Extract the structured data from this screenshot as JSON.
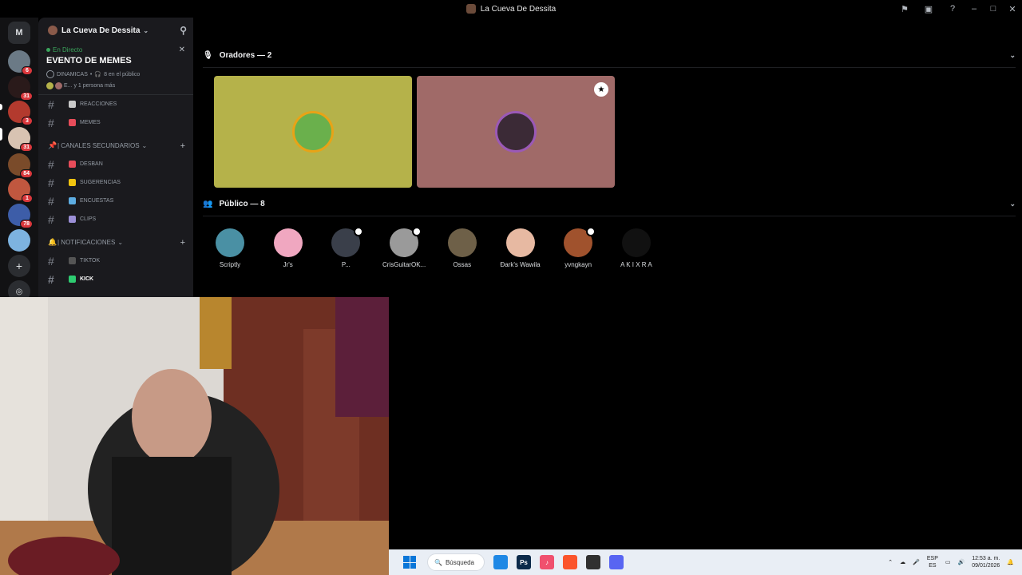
{
  "window": {
    "title": "La Cueva De Dessita"
  },
  "server": {
    "name": "La Cueva De Dessita",
    "rail_badges": [
      "6",
      "31",
      "3",
      "31",
      "84",
      "1",
      "78"
    ]
  },
  "event": {
    "live_label": "En Directo",
    "title": "EVENTO DE MEMES",
    "meta_tag": "DINAMICAS",
    "meta_listeners": "8 en el público",
    "people_text": "E... y 1 persona más"
  },
  "channels_top": [
    {
      "name": "REACCIONES",
      "color": "#c9c9c9"
    },
    {
      "name": "MEMES",
      "color": "#e74c5a"
    }
  ],
  "category_secondary": {
    "label": "| CANALES SECUNDARIOS",
    "channels": [
      {
        "name": "DESBAN",
        "color": "#e74c5a"
      },
      {
        "name": "SUGERENCIAS",
        "color": "#f1c40f"
      },
      {
        "name": "ENCUESTAS",
        "color": "#5dade2"
      },
      {
        "name": "CLIPS",
        "color": "#9b8fd6"
      }
    ]
  },
  "category_notifications": {
    "label": "| NOTIFICACIONES",
    "channels": [
      {
        "name": "TIKTOK",
        "color": "#555555",
        "active": false
      },
      {
        "name": "KICK",
        "color": "#2ecc71",
        "active": true
      }
    ]
  },
  "stage": {
    "speakers_label": "Oradores — 2",
    "audience_label": "Público — 8",
    "speakers": [
      {
        "bg": "#b5b24a",
        "ring": "#e8a317"
      },
      {
        "bg": "#a06a68",
        "ring": "#9b59b6"
      }
    ],
    "audience": [
      {
        "name": "Scriptly",
        "color": "#4a90a4",
        "hand": false
      },
      {
        "name": "Jr's",
        "color": "#f0a7c0",
        "hand": false
      },
      {
        "name": "P...",
        "color": "#3a3f4a",
        "hand": true
      },
      {
        "name": "CrisGuitarOK...",
        "color": "#9a9a9a",
        "hand": true
      },
      {
        "name": "Ossas",
        "color": "#6e6048",
        "hand": false
      },
      {
        "name": "Ðark's Wawila",
        "color": "#e7b9a2",
        "hand": false
      },
      {
        "name": "yvngkayn",
        "color": "#a0522d",
        "hand": true
      },
      {
        "name": "A K I X R A",
        "color": "#111111",
        "hand": false
      }
    ]
  },
  "taskbar": {
    "search_label": "Búsqueda",
    "lang_top": "ESP",
    "lang_bottom": "ES",
    "time": "12:53 a. m.",
    "date": "09/01/2026",
    "apps": [
      {
        "icon": "file-explorer-icon",
        "color": "#1e88e5",
        "label": ""
      },
      {
        "icon": "photoshop-icon",
        "color": "#0b2a4a",
        "label": "Ps"
      },
      {
        "icon": "music-icon",
        "color": "#f0506e",
        "label": "♪"
      },
      {
        "icon": "brave-icon",
        "color": "#fb542b",
        "label": ""
      },
      {
        "icon": "obs-icon",
        "color": "#303030",
        "label": ""
      },
      {
        "icon": "discord-icon",
        "color": "#5865f2",
        "label": ""
      }
    ]
  }
}
